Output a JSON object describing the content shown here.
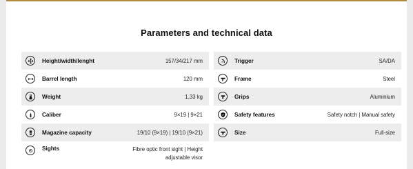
{
  "section": {
    "title": "Parameters and technical data"
  },
  "colors": {
    "accent": "#b08a3e",
    "row_shade": "#ededed",
    "page_bg": "#ebebeb"
  },
  "left_params": [
    {
      "label": "Height/width/lenght",
      "value": "157/34/217 mm",
      "icon": "dimensions-icon"
    },
    {
      "label": "Barrel length",
      "value": "120 mm",
      "icon": "barrel-length-icon"
    },
    {
      "label": "Weight",
      "value": "1,33 kg",
      "icon": "weight-icon"
    },
    {
      "label": "Caliber",
      "value": "9×19 | 9×21",
      "icon": "caliber-icon"
    },
    {
      "label": "Magazine capacity",
      "value": "19/10 (9×19) | 19/10 (9×21)",
      "icon": "magazine-icon"
    },
    {
      "label": "Sights",
      "value": "Fibre optic front sight | Height adjustable visor",
      "icon": "sights-icon"
    }
  ],
  "right_params": [
    {
      "label": "Trigger",
      "value": "SA/DA",
      "icon": "trigger-icon"
    },
    {
      "label": "Frame",
      "value": "Steel",
      "icon": "frame-icon"
    },
    {
      "label": "Grips",
      "value": "Aluminium",
      "icon": "grips-icon"
    },
    {
      "label": "Safety features",
      "value": "Safety notch | Manual safety",
      "icon": "safety-icon"
    },
    {
      "label": "Size",
      "value": "Full-size",
      "icon": "size-icon"
    }
  ]
}
